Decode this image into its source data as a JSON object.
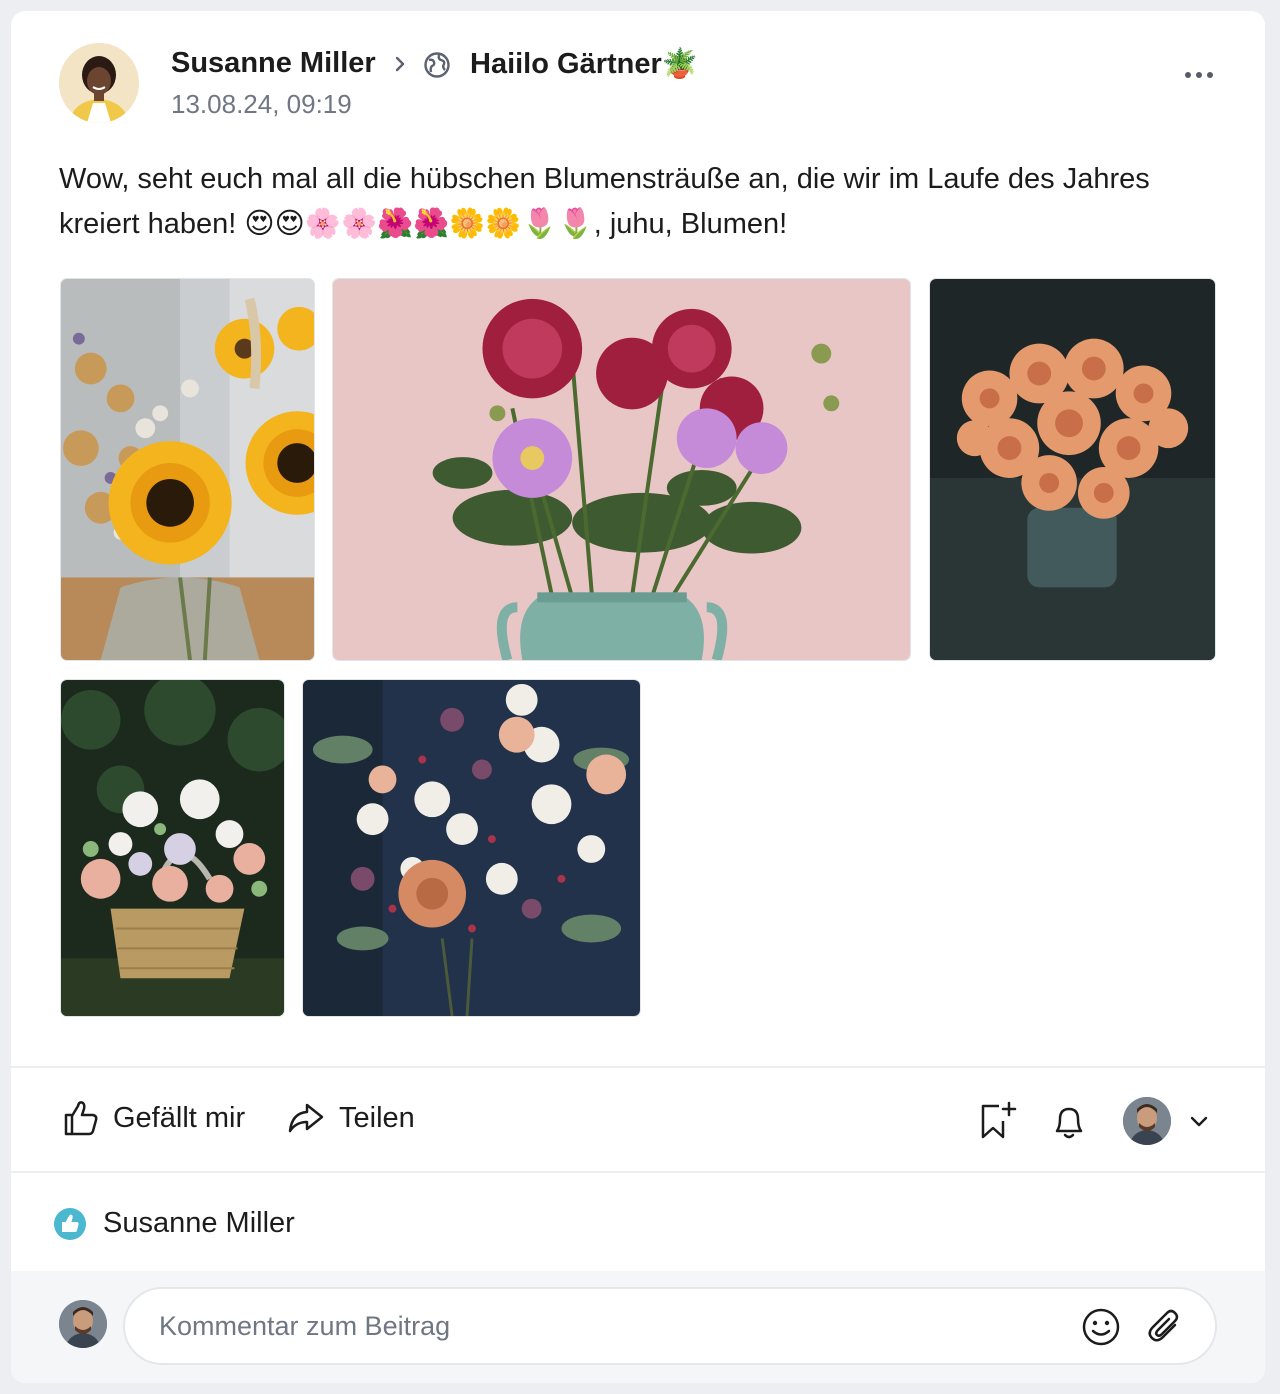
{
  "post": {
    "author_name": "Susanne Miller",
    "community_name": "Haiilo Gärtner",
    "community_emoji": "🪴",
    "timestamp": "13.08.24, 09:19",
    "text_line1": "Wow, seht euch mal all die hübschen Blumensträuße an, die wir im Laufe des Jahres",
    "text_line2_start": "kreiert haben! ",
    "text_emojis": "😍😍🌸🌸🌺🌺🌼🌼🌷🌷",
    "text_line2_end": ", juhu, Blumen!"
  },
  "photos": [
    {
      "name": "sunflower-bouquet-photo",
      "subject": "sunflowers"
    },
    {
      "name": "dahlia-vase-photo",
      "subject": "dahlias"
    },
    {
      "name": "ranunculus-bouquet-photo",
      "subject": "ranunculus"
    },
    {
      "name": "flower-basket-photo",
      "subject": "basket"
    },
    {
      "name": "mixed-bouquet-photo",
      "subject": "roses"
    }
  ],
  "actions": {
    "like_label": "Gefällt mir",
    "share_label": "Teilen"
  },
  "likes": {
    "liker": "Susanne Miller"
  },
  "comment": {
    "placeholder": "Kommentar zum Beitrag"
  },
  "colors": {
    "like_badge": "#4bb8cf",
    "muted_text": "#707784",
    "icon": "#1c1c1c"
  },
  "icons": [
    "chevron-right-icon",
    "globe-icon",
    "more-icon",
    "thumbs-up-icon",
    "share-icon",
    "bookmark-add-icon",
    "bell-icon",
    "chevron-down-icon",
    "smiley-icon",
    "paperclip-icon"
  ]
}
